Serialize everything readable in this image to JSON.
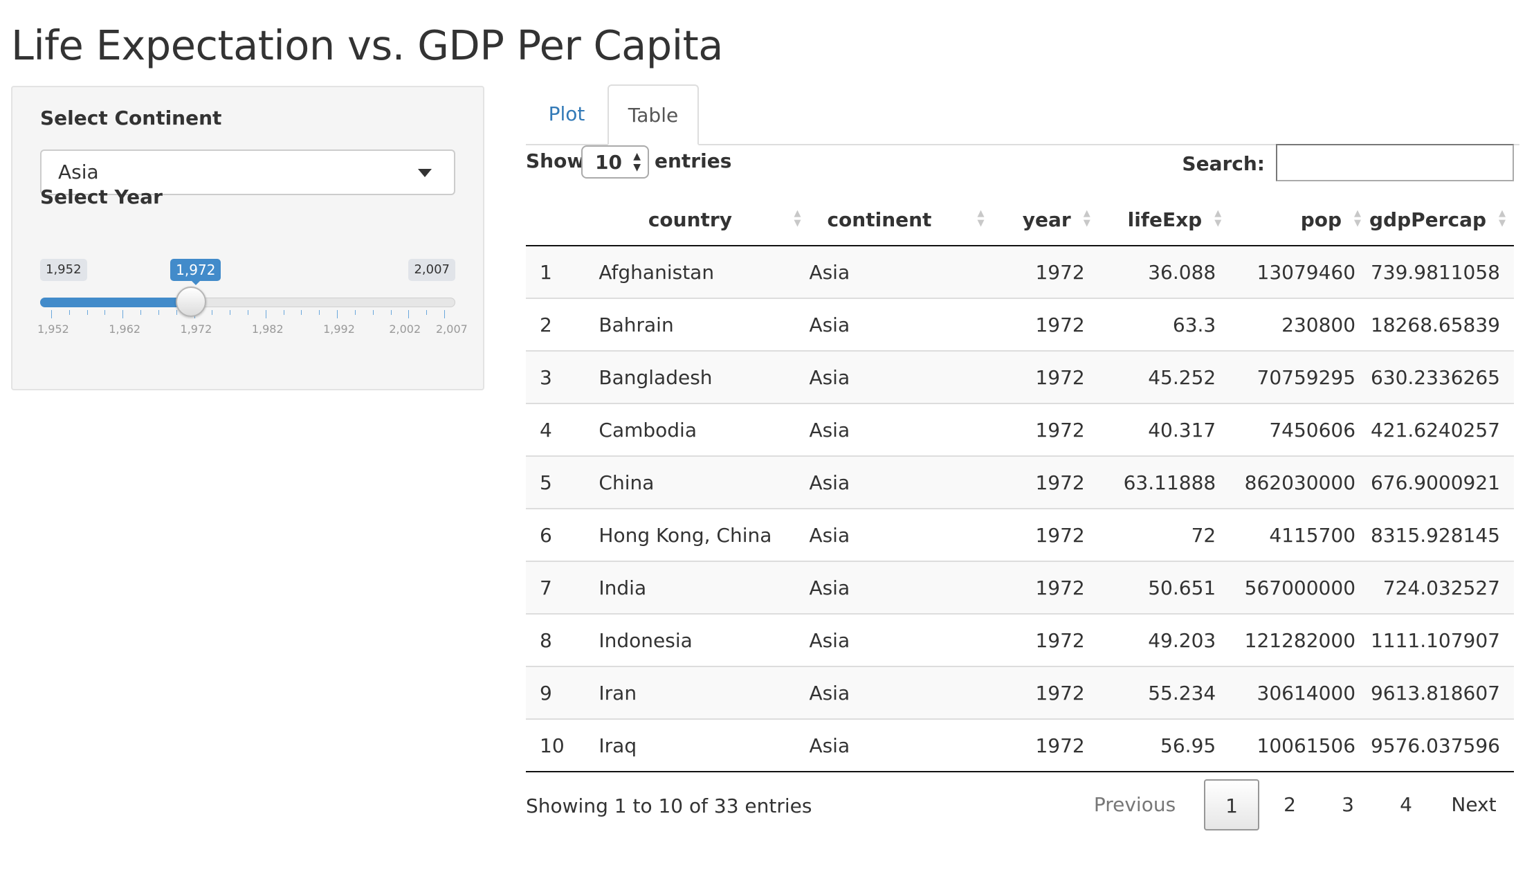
{
  "page": {
    "title": "Life Expectation vs. GDP Per Capita"
  },
  "sidebar": {
    "continent_label": "Select Continent",
    "continent_value": "Asia",
    "year_label": "Select Year",
    "slider": {
      "min": 1952,
      "max": 2007,
      "value": 1972,
      "min_label": "1,952",
      "max_label": "2,007",
      "value_label": "1,972",
      "tick_labels": [
        "1,952",
        "1,962",
        "1,972",
        "1,982",
        "1,992",
        "2,002",
        "2,007"
      ]
    }
  },
  "tabs": [
    {
      "label": "Plot",
      "active": false
    },
    {
      "label": "Table",
      "active": true
    }
  ],
  "table_controls": {
    "show_label": "Show",
    "length_value": "10",
    "entries_label": "entries",
    "search_label": "Search:",
    "search_value": ""
  },
  "table": {
    "columns": [
      "",
      "country",
      "continent",
      "year",
      "lifeExp",
      "pop",
      "gdpPercap"
    ],
    "rows": [
      [
        "1",
        "Afghanistan",
        "Asia",
        "1972",
        "36.088",
        "13079460",
        "739.9811058"
      ],
      [
        "2",
        "Bahrain",
        "Asia",
        "1972",
        "63.3",
        "230800",
        "18268.65839"
      ],
      [
        "3",
        "Bangladesh",
        "Asia",
        "1972",
        "45.252",
        "70759295",
        "630.2336265"
      ],
      [
        "4",
        "Cambodia",
        "Asia",
        "1972",
        "40.317",
        "7450606",
        "421.6240257"
      ],
      [
        "5",
        "China",
        "Asia",
        "1972",
        "63.11888",
        "862030000",
        "676.9000921"
      ],
      [
        "6",
        "Hong Kong, China",
        "Asia",
        "1972",
        "72",
        "4115700",
        "8315.928145"
      ],
      [
        "7",
        "India",
        "Asia",
        "1972",
        "50.651",
        "567000000",
        "724.032527"
      ],
      [
        "8",
        "Indonesia",
        "Asia",
        "1972",
        "49.203",
        "121282000",
        "1111.107907"
      ],
      [
        "9",
        "Iran",
        "Asia",
        "1972",
        "55.234",
        "30614000",
        "9613.818607"
      ],
      [
        "10",
        "Iraq",
        "Asia",
        "1972",
        "56.95",
        "10061506",
        "9576.037596"
      ]
    ]
  },
  "footer": {
    "info": "Showing 1 to 10 of 33 entries",
    "previous": "Previous",
    "pages": [
      "1",
      "2",
      "3",
      "4"
    ],
    "current_page": "1",
    "next": "Next"
  }
}
